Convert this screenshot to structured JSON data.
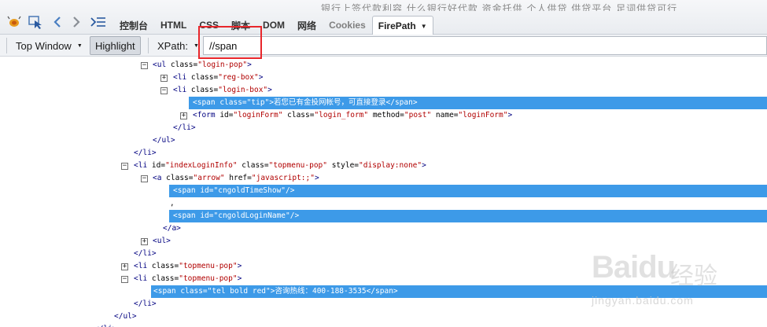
{
  "background_text": "银行上签代款利容   什么银行好代款   资金托供   个人供贷   供贷平台   足词供贷可行",
  "tabs": [
    {
      "label": "控制台",
      "active": false
    },
    {
      "label": "HTML",
      "active": false
    },
    {
      "label": "CSS",
      "active": false
    },
    {
      "label": "脚本",
      "active": false
    },
    {
      "label": "DOM",
      "active": false
    },
    {
      "label": "网络",
      "active": false
    },
    {
      "label": "Cookies",
      "active": false
    },
    {
      "label": "FirePath",
      "active": true
    }
  ],
  "toolbar": {
    "window_label": "Top Window",
    "highlight_label": "Highlight",
    "xpath_label": "XPath:",
    "xpath_value": "//span"
  },
  "tree_rows": [
    {
      "toggle": "minus",
      "selected": false,
      "parts": [
        [
          "tag",
          "<ul "
        ],
        [
          "attr",
          "class="
        ],
        [
          "val",
          "\"login-pop\""
        ],
        [
          "tag",
          ">"
        ]
      ]
    },
    {
      "toggle": "plus",
      "selected": false,
      "parts": [
        [
          "tag",
          "<li "
        ],
        [
          "attr",
          "class="
        ],
        [
          "val",
          "\"reg-box\""
        ],
        [
          "tag",
          ">"
        ]
      ]
    },
    {
      "toggle": "minus",
      "selected": false,
      "parts": [
        [
          "tag",
          "<li "
        ],
        [
          "attr",
          "class="
        ],
        [
          "val",
          "\"login-box\""
        ],
        [
          "tag",
          ">"
        ]
      ]
    },
    {
      "toggle": "",
      "selected": true,
      "parts": [
        [
          "tag",
          "<span "
        ],
        [
          "attr",
          "class="
        ],
        [
          "val",
          "\"tip\""
        ],
        [
          "tag",
          ">"
        ],
        [
          "txt",
          "若您已有金投网帐号，可直接登录"
        ],
        [
          "tag",
          "</span>"
        ]
      ]
    },
    {
      "toggle": "plus",
      "selected": false,
      "parts": [
        [
          "tag",
          "<form "
        ],
        [
          "attr",
          "id="
        ],
        [
          "val",
          "\"loginForm\""
        ],
        [
          "attr",
          " class="
        ],
        [
          "val",
          "\"login_form\""
        ],
        [
          "attr",
          " method="
        ],
        [
          "val",
          "\"post\""
        ],
        [
          "attr",
          " name="
        ],
        [
          "val",
          "\"loginForm\""
        ],
        [
          "tag",
          ">"
        ]
      ]
    },
    {
      "toggle": "",
      "selected": false,
      "parts": [
        [
          "tag",
          "</li>"
        ]
      ]
    },
    {
      "toggle": "",
      "selected": false,
      "parts": [
        [
          "tag",
          "</ul>"
        ]
      ]
    },
    {
      "toggle": "",
      "selected": false,
      "parts": [
        [
          "tag",
          "</li>"
        ]
      ]
    },
    {
      "toggle": "minus",
      "selected": false,
      "parts": [
        [
          "tag",
          "<li "
        ],
        [
          "attr",
          "id="
        ],
        [
          "val",
          "\"indexLoginInfo\""
        ],
        [
          "attr",
          " class="
        ],
        [
          "val",
          "\"topmenu-pop\""
        ],
        [
          "attr",
          " style="
        ],
        [
          "val",
          "\"display:none\""
        ],
        [
          "tag",
          ">"
        ]
      ]
    },
    {
      "toggle": "minus",
      "selected": false,
      "parts": [
        [
          "tag",
          "<a "
        ],
        [
          "attr",
          "class="
        ],
        [
          "val",
          "\"arrow\""
        ],
        [
          "attr",
          " href="
        ],
        [
          "val",
          "\"javascript:;\""
        ],
        [
          "tag",
          ">"
        ]
      ]
    },
    {
      "toggle": "",
      "selected": true,
      "parts": [
        [
          "tag",
          "<span "
        ],
        [
          "attr",
          "id="
        ],
        [
          "val",
          "\"cngoldTimeShow\""
        ],
        [
          "tag",
          "/>"
        ]
      ]
    },
    {
      "toggle": "",
      "selected": false,
      "parts": [
        [
          "txt",
          ","
        ]
      ]
    },
    {
      "toggle": "",
      "selected": true,
      "parts": [
        [
          "tag",
          "<span "
        ],
        [
          "attr",
          "id="
        ],
        [
          "val",
          "\"cngoldLoginName\""
        ],
        [
          "tag",
          "/>"
        ]
      ]
    },
    {
      "toggle": "",
      "selected": false,
      "parts": [
        [
          "tag",
          "</a>"
        ]
      ]
    },
    {
      "toggle": "plus",
      "selected": false,
      "parts": [
        [
          "tag",
          "<ul>"
        ]
      ]
    },
    {
      "toggle": "",
      "selected": false,
      "parts": [
        [
          "tag",
          "</li>"
        ]
      ]
    },
    {
      "toggle": "plus",
      "selected": false,
      "parts": [
        [
          "tag",
          "<li "
        ],
        [
          "attr",
          "class="
        ],
        [
          "val",
          "\"topmenu-pop\""
        ],
        [
          "tag",
          ">"
        ]
      ]
    },
    {
      "toggle": "minus",
      "selected": false,
      "parts": [
        [
          "tag",
          "<li "
        ],
        [
          "attr",
          "class="
        ],
        [
          "val",
          "\"topmenu-pop\""
        ],
        [
          "tag",
          ">"
        ]
      ]
    },
    {
      "toggle": "",
      "selected": true,
      "parts": [
        [
          "tag",
          "<span "
        ],
        [
          "attr",
          "class="
        ],
        [
          "val",
          "\"tel bold red\""
        ],
        [
          "tag",
          ">"
        ],
        [
          "txt",
          "咨询热线：400-188-3535"
        ],
        [
          "tag",
          "</span>"
        ]
      ]
    },
    {
      "toggle": "",
      "selected": false,
      "parts": [
        [
          "tag",
          "</li>"
        ]
      ]
    },
    {
      "toggle": "",
      "selected": false,
      "parts": [
        [
          "tag",
          "</ul>"
        ]
      ]
    },
    {
      "toggle": "",
      "selected": false,
      "parts": [
        [
          "tag",
          "</li>"
        ]
      ]
    }
  ],
  "watermark": {
    "main": "Baidu",
    "cn": "经验",
    "sub": "jingyan.baidu.com"
  },
  "colors": {
    "selection": "#3d9ae8",
    "tag": "#000080",
    "value": "#b10000",
    "annotation": "#e8262b"
  }
}
